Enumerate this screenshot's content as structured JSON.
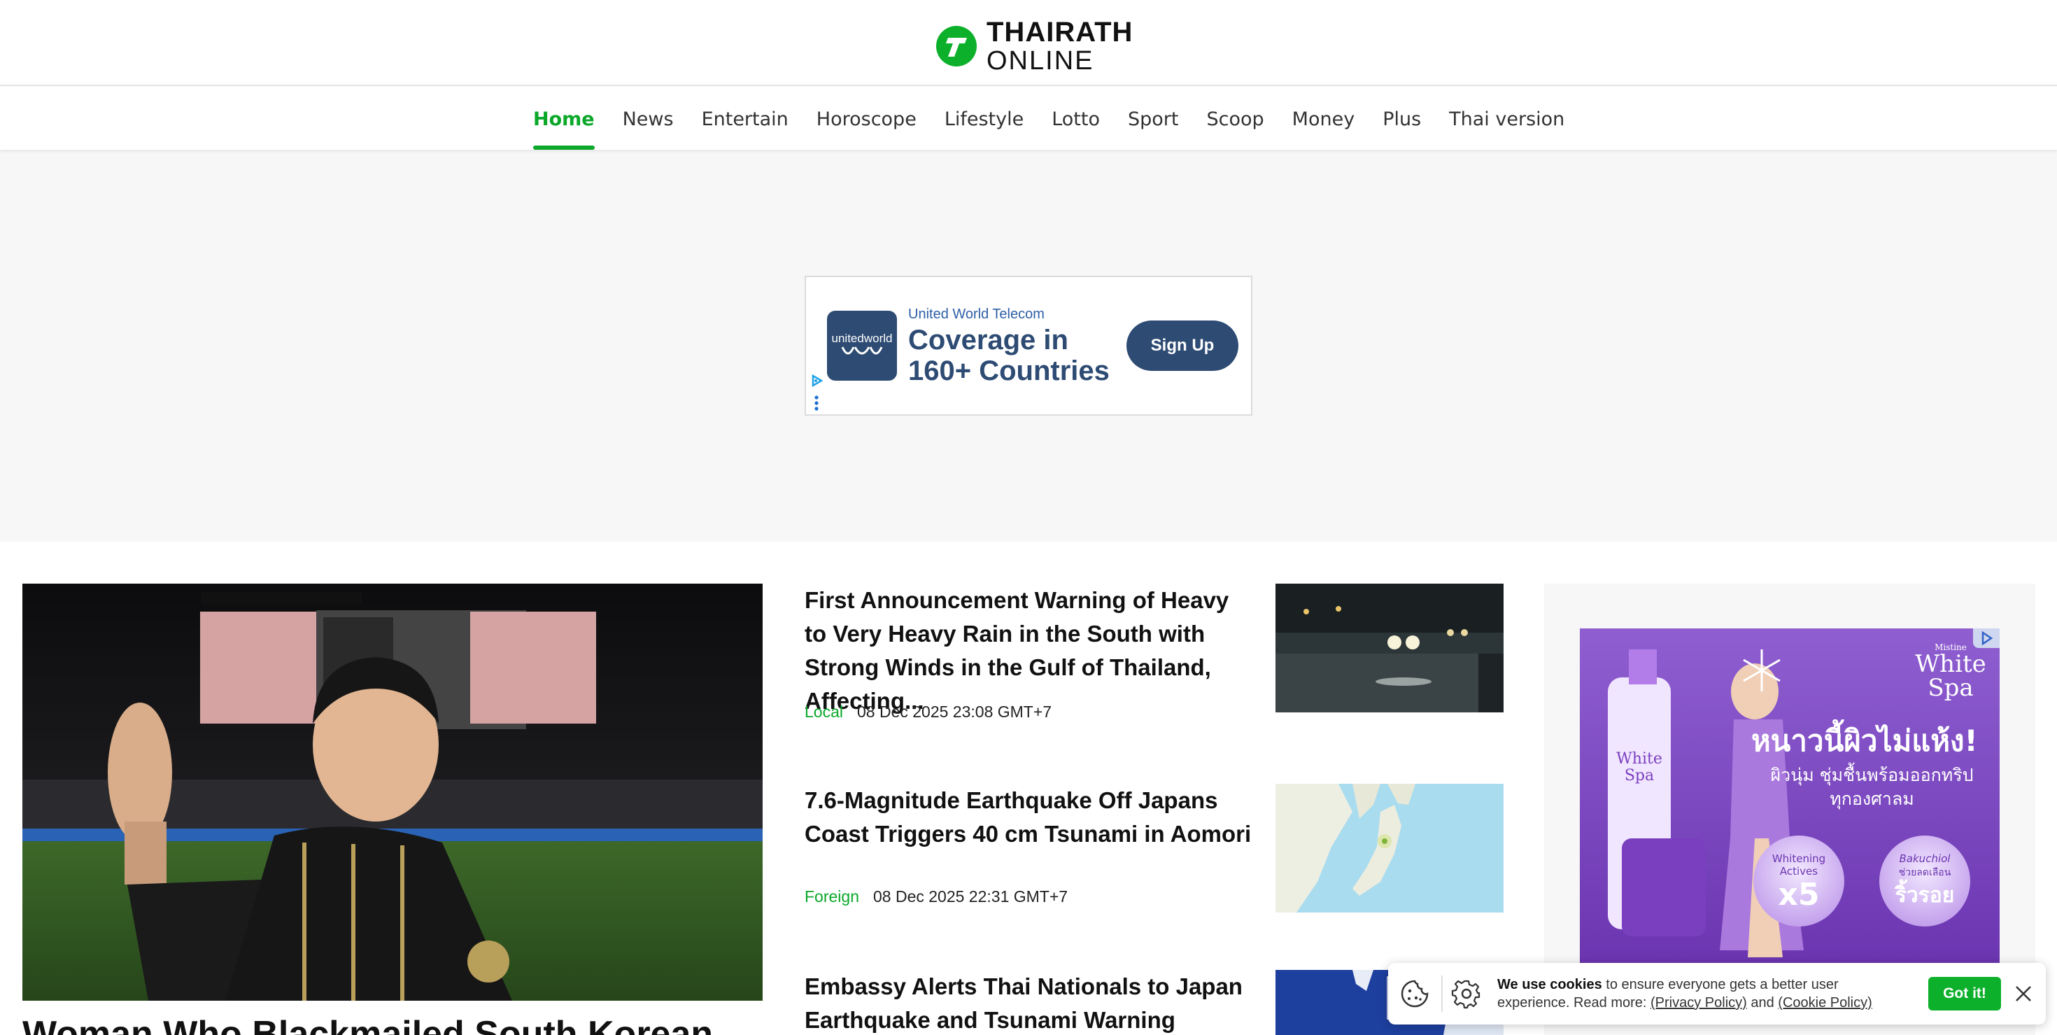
{
  "header": {
    "logo_line1": "THAIRATH",
    "logo_line2": "ONLINE",
    "brand_color": "#0db02b"
  },
  "nav": {
    "items": [
      {
        "label": "Home",
        "active": true
      },
      {
        "label": "News"
      },
      {
        "label": "Entertain"
      },
      {
        "label": "Horoscope"
      },
      {
        "label": "Lifestyle"
      },
      {
        "label": "Lotto"
      },
      {
        "label": "Sport"
      },
      {
        "label": "Scoop"
      },
      {
        "label": "Money"
      },
      {
        "label": "Plus"
      },
      {
        "label": "Thai version"
      }
    ]
  },
  "top_ad": {
    "logo_text": "unitedworld",
    "advertiser": "United World Telecom",
    "headline": "Coverage in 160+ Countries",
    "cta": "Sign Up",
    "color": "#2d4b73"
  },
  "lead": {
    "title": "Woman Who Blackmailed South Korean"
  },
  "stories": [
    {
      "title": "First Announcement Warning of Heavy to Very Heavy Rain in the South with Strong Winds in the Gulf of Thailand, Affecting...",
      "category": "Local",
      "date": "08 Dec 2025 23:08 GMT+7"
    },
    {
      "title": "7.6-Magnitude Earthquake Off Japans Coast Triggers 40 cm Tsunami in Aomori",
      "category": "Foreign",
      "date": "08 Dec 2025 22:31 GMT+7"
    },
    {
      "title": "Embassy Alerts Thai Nationals to Japan Earthquake and Tsunami Warning",
      "category": "",
      "date": ""
    }
  ],
  "side_ad": {
    "brand_line1": "Mistine",
    "brand_line2": "White",
    "brand_line3": "Spa",
    "headline": "หนาวนี้ผิวไม่แห้ง!",
    "subline1": "ผิวนุ่ม ชุ่มชื้นพร้อมออกทริป",
    "subline2": "ทุกองศาลม",
    "badge1_line1": "Whitening",
    "badge1_line2": "Actives",
    "badge1_big": "x5",
    "badge2_line1": "Bakuchiol",
    "badge2_line2": "ช่วยลดเลือน",
    "badge2_big": "ริ้วรอย",
    "bottle_line1": "White",
    "bottle_line2": "Spa"
  },
  "cookie": {
    "bold": "We use cookies",
    "text": " to ensure everyone gets a better user experience. Read more: ",
    "privacy": "(Privacy Policy)",
    "and": " and ",
    "cookie_policy": "(Cookie Policy)",
    "button": "Got it!"
  }
}
